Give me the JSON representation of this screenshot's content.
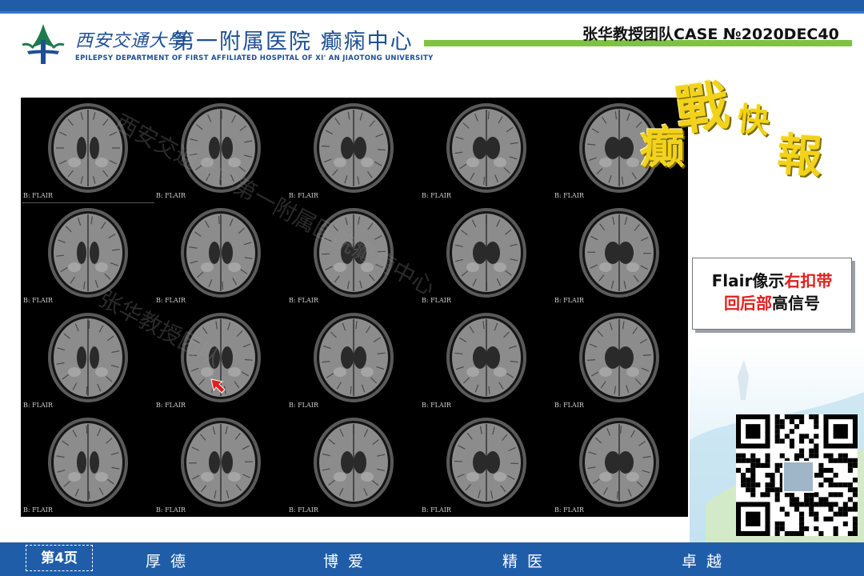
{
  "header": {
    "university_cn": "西安交通大學",
    "department_cn": "第一附属医院 癫痫中心",
    "department_en": "EPILEPSY DEPARTMENT OF FIRST AFFILIATED HOSPITAL OF XI' AN JIAOTONG UNIVERSITY",
    "case_label": "张华教授团队CASE №2020DEC40"
  },
  "colors": {
    "brand_blue": "#1f5da8",
    "accent_green": "#7fc241",
    "highlight_red": "#e0201e",
    "slogan_yellow": "#f2d21a"
  },
  "mri_grid": {
    "rows": 4,
    "cols": 5,
    "slice_labels": [
      "B: FLAIR",
      "B: FLAIR",
      "B: FLAIR",
      "B: FLAIR",
      "B: FLAIR",
      "B: FLAIR",
      "B: FLAIR",
      "B: FLAIR",
      "B: FLAIR",
      "B: FLAIR",
      "B: FLAIR",
      "B: FLAIR",
      "B: FLAIR",
      "B: FLAIR",
      "B: FLAIR",
      "B: FLAIR",
      "B: FLAIR",
      "B: FLAIR",
      "B: FLAIR",
      "B: FLAIR"
    ],
    "marked_slice_index": 11,
    "watermark_lines": [
      "西安交通大学第一附属医院癫痫中心",
      "张华教授团队"
    ]
  },
  "slogan": {
    "chars": [
      "癫",
      "戰",
      "快",
      "報"
    ]
  },
  "finding": {
    "line1_prefix": "Flair像示",
    "line1_highlight": "右扣带",
    "line2_highlight": "回后部",
    "line2_suffix": "高信号"
  },
  "footer": {
    "page_label": "第4页",
    "mottos": [
      "厚德",
      "博爱",
      "精医",
      "卓越"
    ]
  }
}
